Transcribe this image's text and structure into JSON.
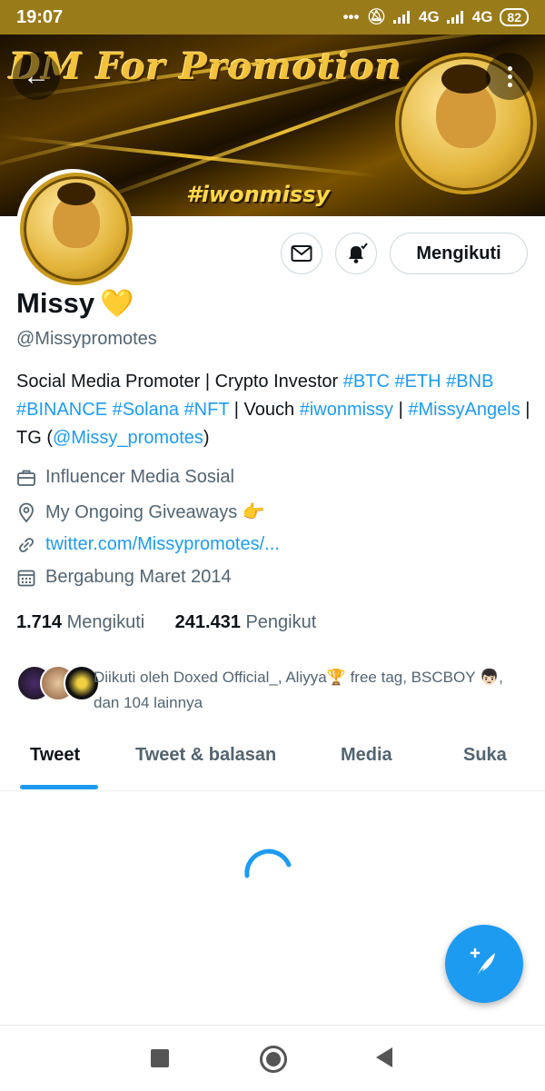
{
  "status_bar": {
    "time": "19:07",
    "network1": "4G",
    "network2": "4G",
    "battery": "82"
  },
  "banner": {
    "title": "DM For Promotion",
    "hashtag": "#iwonmissy"
  },
  "profile": {
    "name": "Missy",
    "name_emoji": "💛",
    "handle": "@Missypromotes",
    "follow_button": "Mengikuti"
  },
  "bio": {
    "segments": [
      {
        "text": "Social Media Promoter | Crypto Investor ",
        "link": false
      },
      {
        "text": "#BTC",
        "link": true
      },
      {
        "text": " ",
        "link": false
      },
      {
        "text": "#ETH",
        "link": true
      },
      {
        "text": " ",
        "link": false
      },
      {
        "text": "#BNB",
        "link": true
      },
      {
        "text": " ",
        "link": false
      },
      {
        "text": "#BINANCE",
        "link": true
      },
      {
        "text": " ",
        "link": false
      },
      {
        "text": "#Solana",
        "link": true
      },
      {
        "text": " ",
        "link": false
      },
      {
        "text": "#NFT",
        "link": true
      },
      {
        "text": " | Vouch ",
        "link": false
      },
      {
        "text": "#iwonmissy",
        "link": true
      },
      {
        "text": " | ",
        "link": false
      },
      {
        "text": "#MissyAngels",
        "link": true
      },
      {
        "text": " | TG  (",
        "link": false
      },
      {
        "text": "@Missy_promotes",
        "link": true
      },
      {
        "text": ")",
        "link": false
      }
    ]
  },
  "meta": {
    "category": "Influencer Media Sosial",
    "location": " My Ongoing Giveaways 👉",
    "website": "twitter.com/Missypromotes/...",
    "joined": "Bergabung Maret 2014"
  },
  "stats": {
    "following_count": "1.714",
    "following_label": "Mengikuti",
    "followers_count": "241.431",
    "followers_label": "Pengikut"
  },
  "followed_by": {
    "text": "Diikuti oleh Doxed Official_, Aliyya🏆 free tag, BSCBOY 👦🏻, dan 104 lainnya"
  },
  "tabs": [
    {
      "label": "Tweet",
      "active": true
    },
    {
      "label": "Tweet & balasan",
      "active": false
    },
    {
      "label": "Media",
      "active": false
    },
    {
      "label": "Suka",
      "active": false
    }
  ],
  "colors": {
    "accent": "#1d9bf0",
    "status_bar": "#9a7b1a",
    "text_secondary": "#536471"
  },
  "icons": [
    "back-arrow-icon",
    "more-icon",
    "envelope-icon",
    "bell-icon",
    "briefcase-icon",
    "location-pin-icon",
    "link-icon",
    "calendar-icon",
    "compose-tweet-icon"
  ]
}
